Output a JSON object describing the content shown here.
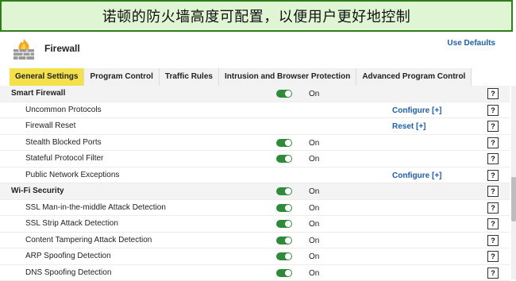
{
  "banner": {
    "text": "诺顿的防火墙高度可配置，以便用户更好地控制"
  },
  "header": {
    "title": "Firewall",
    "use_defaults": "Use Defaults",
    "icon": "firewall-icon"
  },
  "tabs": [
    {
      "label": "General Settings",
      "active": true
    },
    {
      "label": "Program Control",
      "active": false
    },
    {
      "label": "Traffic Rules",
      "active": false
    },
    {
      "label": "Intrusion and Browser Protection",
      "active": false
    },
    {
      "label": "Advanced Program Control",
      "active": false
    }
  ],
  "rows": [
    {
      "label": "Smart Firewall",
      "section": true,
      "toggle": true,
      "state": "On",
      "help": "?"
    },
    {
      "label": "Uncommon Protocols",
      "action": "Configure [+]",
      "help": "?"
    },
    {
      "label": "Firewall Reset",
      "action": "Reset [+]",
      "help": "?"
    },
    {
      "label": "Stealth Blocked Ports",
      "toggle": true,
      "state": "On",
      "help": "?"
    },
    {
      "label": "Stateful Protocol Filter",
      "toggle": true,
      "state": "On",
      "help": "?"
    },
    {
      "label": "Public Network Exceptions",
      "action": "Configure [+]",
      "help": "?"
    },
    {
      "label": "Wi-Fi Security",
      "section": true,
      "toggle": true,
      "state": "On",
      "help": "?"
    },
    {
      "label": "SSL Man-in-the-middle Attack Detection",
      "toggle": true,
      "state": "On",
      "help": "?"
    },
    {
      "label": "SSL Strip Attack Detection",
      "toggle": true,
      "state": "On",
      "help": "?"
    },
    {
      "label": "Content Tampering Attack Detection",
      "toggle": true,
      "state": "On",
      "help": "?"
    },
    {
      "label": "ARP Spoofing Detection",
      "toggle": true,
      "state": "On",
      "help": "?"
    },
    {
      "label": "DNS Spoofing Detection",
      "toggle": true,
      "state": "On",
      "help": "?"
    }
  ],
  "colors": {
    "accent_tab": "#f4e04a",
    "toggle_on": "#2f8a3a",
    "link": "#1f5fa8",
    "banner_bg": "#dff5d3",
    "banner_border": "#2e7d1b"
  }
}
